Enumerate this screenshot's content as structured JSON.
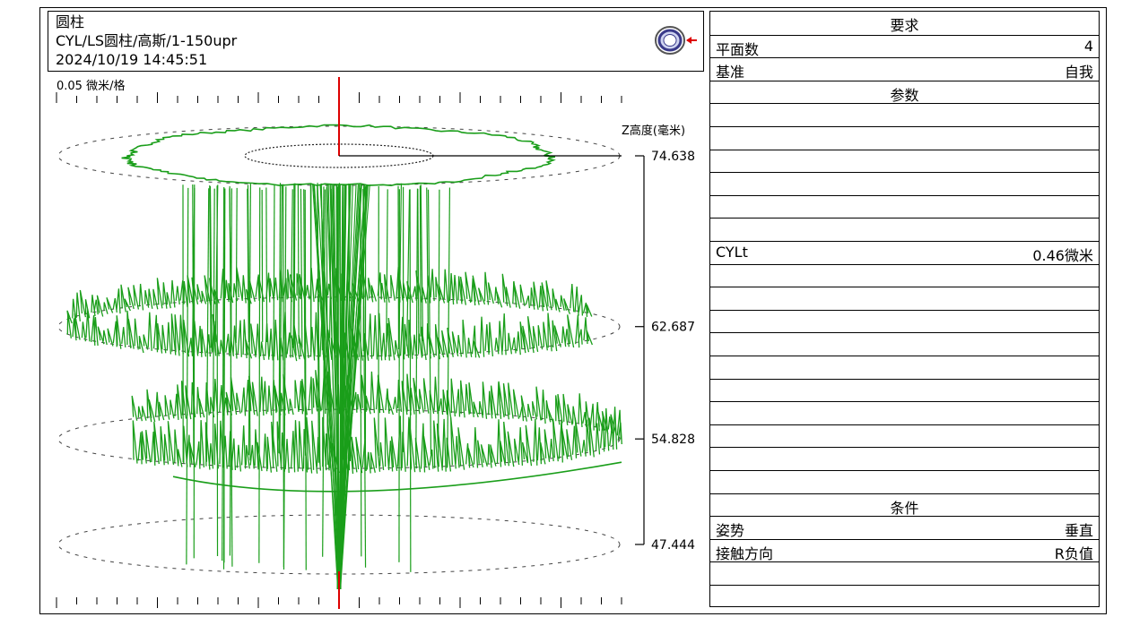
{
  "header": {
    "title": "圆柱",
    "subtitle": "CYL/LS圆柱/高斯/1-150upr",
    "datetime": "2024/10/19 14:45:51"
  },
  "chart_data": {
    "type": "line",
    "scale_label": "0.05 微米/格",
    "z_axis_label": "Z高度(毫米)",
    "z_levels": [
      "74.638",
      "62.687",
      "54.828",
      "47.444"
    ],
    "z_values": [
      74.638,
      62.687,
      54.828,
      47.444
    ],
    "series_color": "#1a9e1a",
    "reference_color": "#dd0000",
    "grid": false
  },
  "panel": {
    "requirements_header": "要求",
    "plane_count_label": "平面数",
    "plane_count_value": "4",
    "datum_label": "基准",
    "datum_value": "自我",
    "params_header": "参数",
    "cylt_label": "CYLt",
    "cylt_value": "0.46微米",
    "conditions_header": "条件",
    "posture_label": "姿势",
    "posture_value": "垂直",
    "contact_label": "接触方向",
    "contact_value": "R负值"
  }
}
